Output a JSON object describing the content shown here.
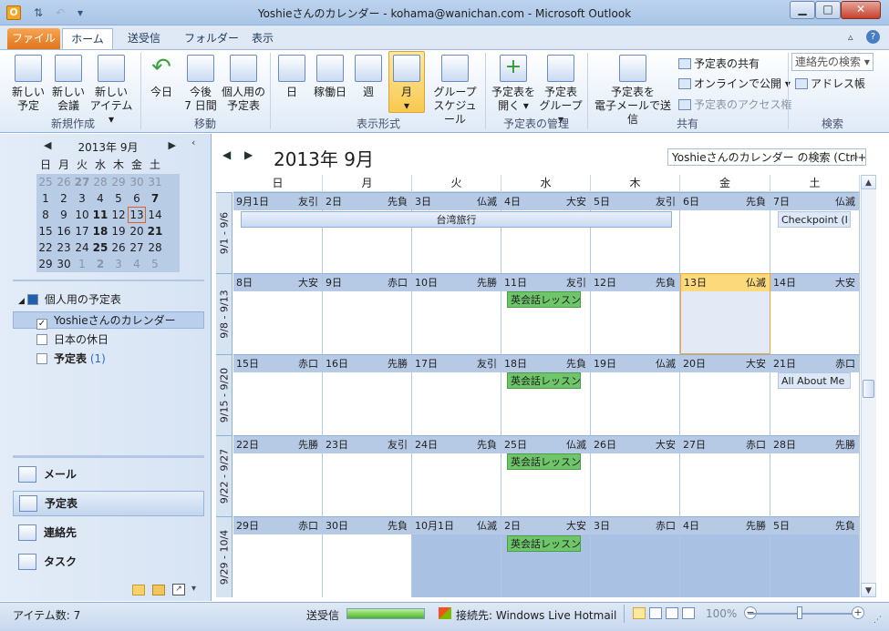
{
  "window": {
    "title": "Yoshieさんのカレンダー - kohama@wanichan.com - Microsoft Outlook",
    "min": "▁",
    "max": "□",
    "close": "✕"
  },
  "tabs": {
    "file": "ファイル",
    "home": "ホーム",
    "send": "送受信",
    "folder": "フォルダー",
    "view": "表示"
  },
  "ribbon": {
    "new_appt": [
      "新しい",
      "予定"
    ],
    "new_meeting": [
      "新しい",
      "会議"
    ],
    "new_items": [
      "新しい",
      "アイテム ▾"
    ],
    "grp_new": "新規作成",
    "today": "今日",
    "next7": [
      "今後",
      "7 日間"
    ],
    "personal": [
      "個人用の",
      "予定表"
    ],
    "grp_move": "移動",
    "day": "日",
    "workweek": "稼働日",
    "week": "週",
    "month": "月",
    "group_sched": [
      "グループ",
      "スケジュール"
    ],
    "grp_view": "表示形式",
    "open_cal": [
      "予定表を",
      "開く ▾"
    ],
    "cal_groups": [
      "予定表",
      "グループ ▾"
    ],
    "grp_manage": "予定表の管理",
    "email_cal": [
      "予定表を",
      "電子メールで送信"
    ],
    "share_cal": "予定表の共有",
    "publish": "オンラインで公開 ▾",
    "perm": "予定表のアクセス権",
    "grp_share": "共有",
    "addr_search": "連絡先の検索",
    "addr_book": "アドレス帳",
    "grp_find": "検索"
  },
  "minical": {
    "title": "2013年 9月",
    "dow": [
      "日",
      "月",
      "火",
      "水",
      "木",
      "金",
      "土"
    ],
    "weeks": [
      [
        "25",
        "26",
        "27",
        "28",
        "29",
        "30",
        "31"
      ],
      [
        "1",
        "2",
        "3",
        "4",
        "5",
        "6",
        "7"
      ],
      [
        "8",
        "9",
        "10",
        "11",
        "12",
        "13",
        "14"
      ],
      [
        "15",
        "16",
        "17",
        "18",
        "19",
        "20",
        "21"
      ],
      [
        "22",
        "23",
        "24",
        "25",
        "26",
        "27",
        "28"
      ],
      [
        "29",
        "30",
        "1",
        "2",
        "3",
        "4",
        "5"
      ]
    ]
  },
  "nav": {
    "group": "個人用の予定表",
    "cal1": "Yoshieさんのカレンダー",
    "cal2": "日本の休日",
    "cal3": "予定表",
    "cal3_count": "(1)",
    "mail": "メール",
    "calendar": "予定表",
    "contacts": "連絡先",
    "tasks": "タスク"
  },
  "calendar": {
    "title": "2013年 9月",
    "search_placeholder": "Yoshieさんのカレンダー の検索 (Ctrl+E)",
    "dow": [
      "日",
      "月",
      "火",
      "水",
      "木",
      "金",
      "土"
    ],
    "week_labels": [
      "9/1 - 9/6",
      "9/8 - 9/13",
      "9/15 - 9/20",
      "9/22 - 9/27",
      "9/29 - 10/4"
    ],
    "weeks": [
      [
        [
          "9月1日",
          "友引"
        ],
        [
          "2日",
          "先負"
        ],
        [
          "3日",
          "仏滅"
        ],
        [
          "4日",
          "大安"
        ],
        [
          "5日",
          "友引"
        ],
        [
          "6日",
          "先負"
        ],
        [
          "7日",
          "仏滅"
        ]
      ],
      [
        [
          "8日",
          "大安"
        ],
        [
          "9日",
          "赤口"
        ],
        [
          "10日",
          "先勝"
        ],
        [
          "11日",
          "友引"
        ],
        [
          "12日",
          "先負"
        ],
        [
          "13日",
          "仏滅"
        ],
        [
          "14日",
          "大安"
        ]
      ],
      [
        [
          "15日",
          "赤口"
        ],
        [
          "16日",
          "先勝"
        ],
        [
          "17日",
          "友引"
        ],
        [
          "18日",
          "先負"
        ],
        [
          "19日",
          "仏滅"
        ],
        [
          "20日",
          "大安"
        ],
        [
          "21日",
          "赤口"
        ]
      ],
      [
        [
          "22日",
          "先勝"
        ],
        [
          "23日",
          "友引"
        ],
        [
          "24日",
          "先負"
        ],
        [
          "25日",
          "仏滅"
        ],
        [
          "26日",
          "大安"
        ],
        [
          "27日",
          "赤口"
        ],
        [
          "28日",
          "先勝"
        ]
      ],
      [
        [
          "29日",
          "赤口"
        ],
        [
          "30日",
          "先負"
        ],
        [
          "10月1日",
          "仏滅"
        ],
        [
          "2日",
          "大安"
        ],
        [
          "3日",
          "赤口"
        ],
        [
          "4日",
          "先勝"
        ],
        [
          "5日",
          "先負"
        ]
      ]
    ],
    "events": {
      "taiwan": "台湾旅行",
      "checkpoint": "Checkpoint (I",
      "eikaiwa": "英会話レッスン",
      "allabout": "All About Me"
    }
  },
  "status": {
    "items": "アイテム数: 7",
    "sendrecv": "送受信",
    "progress": 1.0,
    "connected": "接続先: Windows Live Hotmail",
    "zoom": "100%"
  }
}
